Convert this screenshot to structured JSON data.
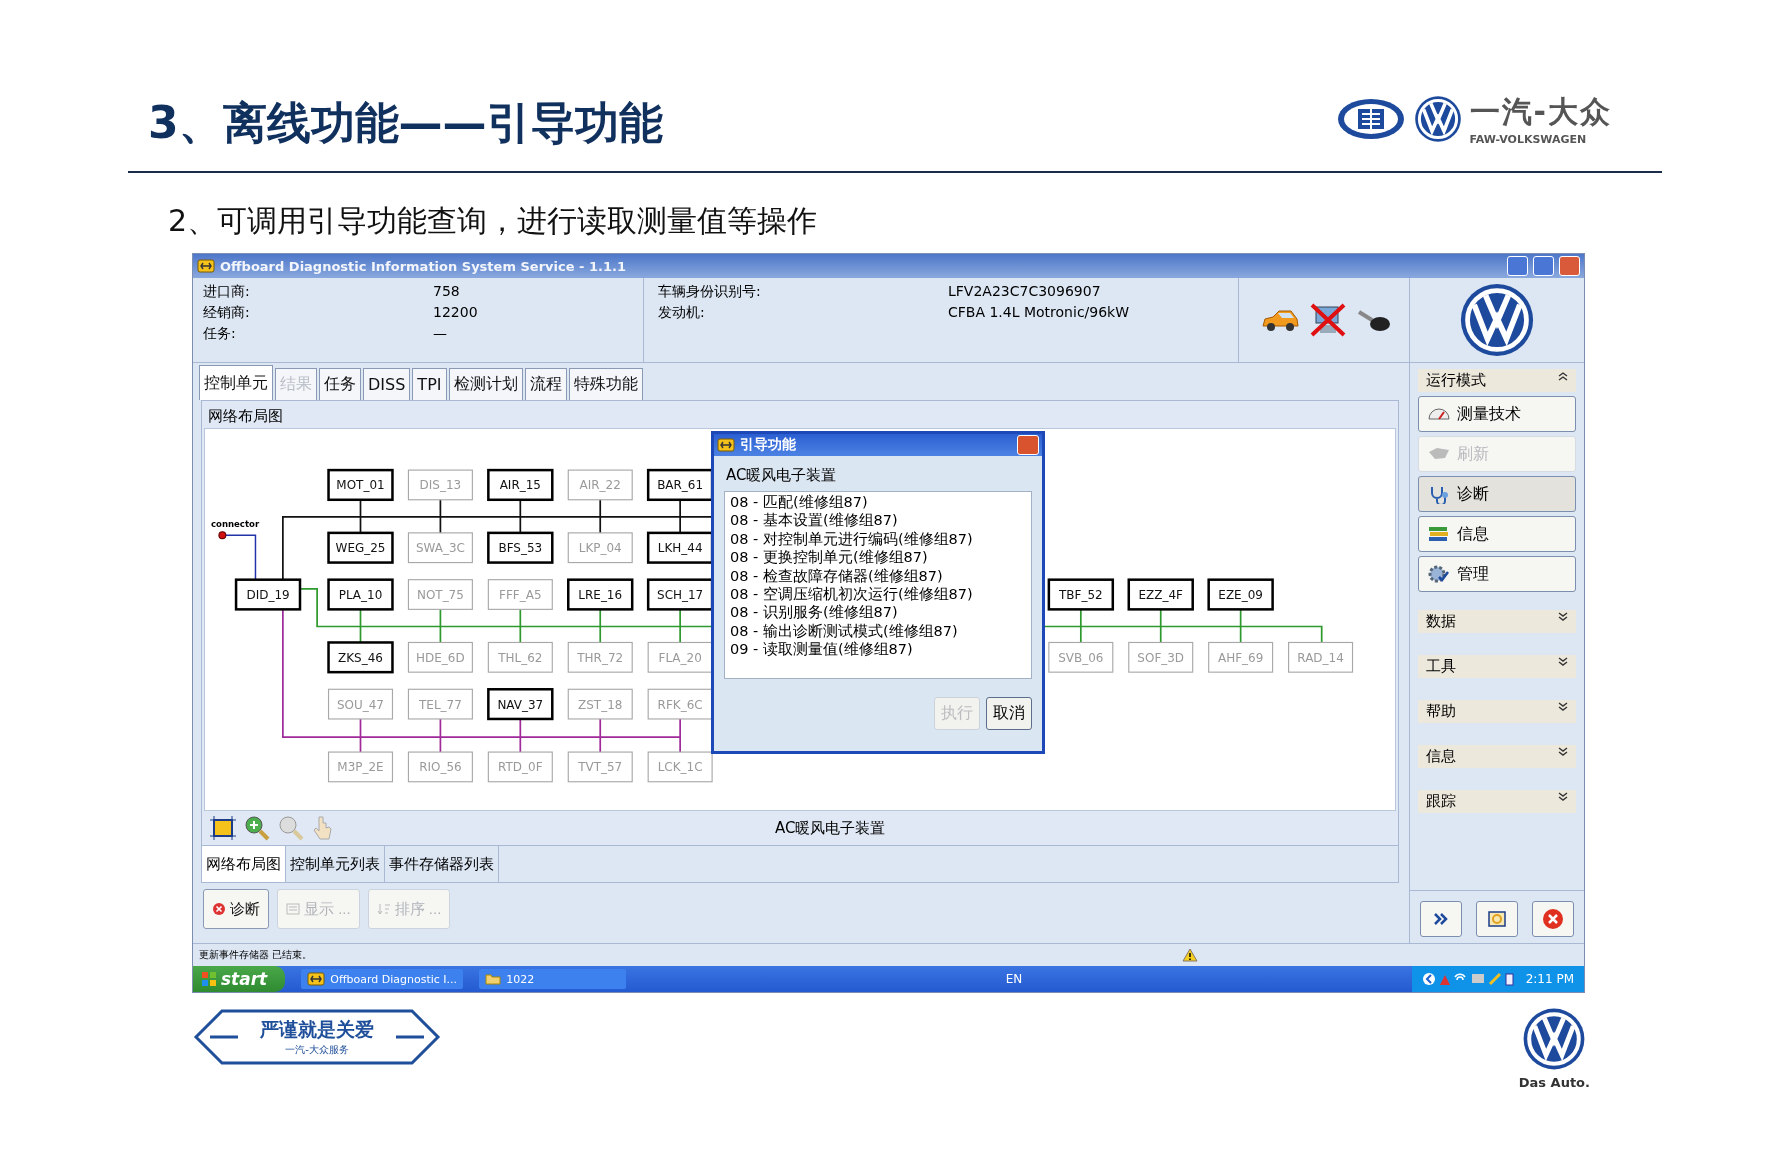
{
  "slide": {
    "title": "3、离线功能——引导功能",
    "subtitle": "2、可调用引导功能查询，进行读取测量值等操作",
    "brand": {
      "name": "一汽-大众",
      "subname": "FAW-VOLKSWAGEN"
    },
    "footer": {
      "slogan": "严谨就是关爱",
      "slogan_sub": "一汽-大众服务",
      "tagline": "Das Auto."
    }
  },
  "window": {
    "title": "Offboard Diagnostic Information System Service - 1.1.1",
    "info_left": [
      {
        "label": "进口商:",
        "value": "758"
      },
      {
        "label": "经销商:",
        "value": "12200"
      },
      {
        "label": "任务:",
        "value": "—"
      }
    ],
    "info_right": [
      {
        "label": "车辆身份识别号:",
        "value": "LFV2A23C7C3096907"
      },
      {
        "label": "发动机:",
        "value": "CFBA 1.4L Motronic/96kW"
      }
    ],
    "tabs": [
      {
        "label": "控制单元",
        "selected": true,
        "disabled": false
      },
      {
        "label": "结果",
        "selected": false,
        "disabled": true
      },
      {
        "label": "任务",
        "selected": false,
        "disabled": false
      },
      {
        "label": "DISS",
        "selected": false,
        "disabled": false
      },
      {
        "label": "TPI",
        "selected": false,
        "disabled": false
      },
      {
        "label": "检测计划",
        "selected": false,
        "disabled": false
      },
      {
        "label": "流程",
        "selected": false,
        "disabled": false
      },
      {
        "label": "特殊功能",
        "selected": false,
        "disabled": false
      }
    ],
    "panel_title": "网络布局图",
    "diagram": {
      "connector_label": "connector",
      "gateway": {
        "label": "DID_19",
        "active": true
      },
      "grid": [
        [
          {
            "label": "MOT_01",
            "active": true
          },
          {
            "label": "DIS_13",
            "active": false
          },
          {
            "label": "AIR_15",
            "active": true
          },
          {
            "label": "AIR_22",
            "active": false
          },
          {
            "label": "BAR_61",
            "active": true
          }
        ],
        [
          {
            "label": "WEG_25",
            "active": true
          },
          {
            "label": "SWA_3C",
            "active": false
          },
          {
            "label": "BFS_53",
            "active": true
          },
          {
            "label": "LKP_04",
            "active": false
          },
          {
            "label": "LKH_44",
            "active": true
          }
        ],
        [
          {
            "label": "PLA_10",
            "active": true
          },
          {
            "label": "NOT_75",
            "active": false
          },
          {
            "label": "FFF_A5",
            "active": false
          },
          {
            "label": "LRE_16",
            "active": true
          },
          {
            "label": "SCH_17",
            "active": true
          }
        ],
        [
          {
            "label": "ZKS_46",
            "active": true
          },
          {
            "label": "HDE_6D",
            "active": false
          },
          {
            "label": "THL_62",
            "active": false
          },
          {
            "label": "THR_72",
            "active": false
          },
          {
            "label": "FLA_20",
            "active": false
          }
        ],
        [
          {
            "label": "SOU_47",
            "active": false
          },
          {
            "label": "TEL_77",
            "active": false
          },
          {
            "label": "NAV_37",
            "active": true
          },
          {
            "label": "ZST_18",
            "active": false
          },
          {
            "label": "RFK_6C",
            "active": false
          }
        ],
        [
          {
            "label": "M3P_2E",
            "active": false
          },
          {
            "label": "RIO_56",
            "active": false
          },
          {
            "label": "RTD_0F",
            "active": false
          },
          {
            "label": "TVT_57",
            "active": false
          },
          {
            "label": "LCK_1C",
            "active": false
          }
        ]
      ],
      "right_top": [
        {
          "label": "TBF_52",
          "active": true
        },
        {
          "label": "EZZ_4F",
          "active": true
        },
        {
          "label": "EZE_09",
          "active": true
        }
      ],
      "right_bottom": [
        {
          "label": "SVB_06",
          "active": false
        },
        {
          "label": "SOF_3D",
          "active": false
        },
        {
          "label": "AHF_69",
          "active": false
        },
        {
          "label": "RAD_14",
          "active": false
        }
      ]
    },
    "canvas_caption": "AC暖风电子装置",
    "view_tabs": [
      {
        "label": "网络布局图",
        "selected": true
      },
      {
        "label": "控制单元列表",
        "selected": false
      },
      {
        "label": "事件存储器列表",
        "selected": false
      }
    ],
    "actions": [
      {
        "label": "诊断",
        "disabled": false
      },
      {
        "label": "显示 ...",
        "disabled": true
      },
      {
        "label": "排序 ...",
        "disabled": true
      }
    ],
    "sidebar": [
      {
        "title": "运行模式",
        "expanded": true,
        "items": [
          {
            "label": "测量技术",
            "kind": "gauge",
            "disabled": false,
            "selected": false
          },
          {
            "label": "刷新",
            "kind": "flash",
            "disabled": true,
            "selected": false
          },
          {
            "label": "诊断",
            "kind": "stethoscope",
            "disabled": false,
            "selected": true
          },
          {
            "label": "信息",
            "kind": "books",
            "disabled": false,
            "selected": false
          },
          {
            "label": "管理",
            "kind": "gear",
            "disabled": false,
            "selected": false
          }
        ]
      },
      {
        "title": "数据",
        "expanded": false
      },
      {
        "title": "工具",
        "expanded": false
      },
      {
        "title": "帮助",
        "expanded": false
      },
      {
        "title": "信息",
        "expanded": false
      },
      {
        "title": "跟踪",
        "expanded": false
      }
    ],
    "status": "更新事件存储器 已结束。",
    "dialog": {
      "title": "引导功能",
      "heading": "AC暖风电子装置",
      "items": [
        "08 - 匹配(维修组87)",
        "08 - 基本设置(维修组87)",
        "08 - 对控制单元进行编码(维修组87)",
        "08 - 更换控制单元(维修组87)",
        "08 - 检查故障存储器(维修组87)",
        "08 - 空调压缩机初次运行(维修组87)",
        "08 - 识别服务(维修组87)",
        "08 - 输出诊断测试模式(维修组87)",
        "09 - 读取测量值(维修组87)"
      ],
      "buttons": [
        {
          "label": "执行",
          "disabled": true
        },
        {
          "label": "取消",
          "disabled": false
        }
      ]
    },
    "taskbar": {
      "start": "start",
      "items": [
        "Offboard Diagnostic I...",
        "1022"
      ],
      "language": "EN",
      "clock": "2:11 PM"
    }
  }
}
